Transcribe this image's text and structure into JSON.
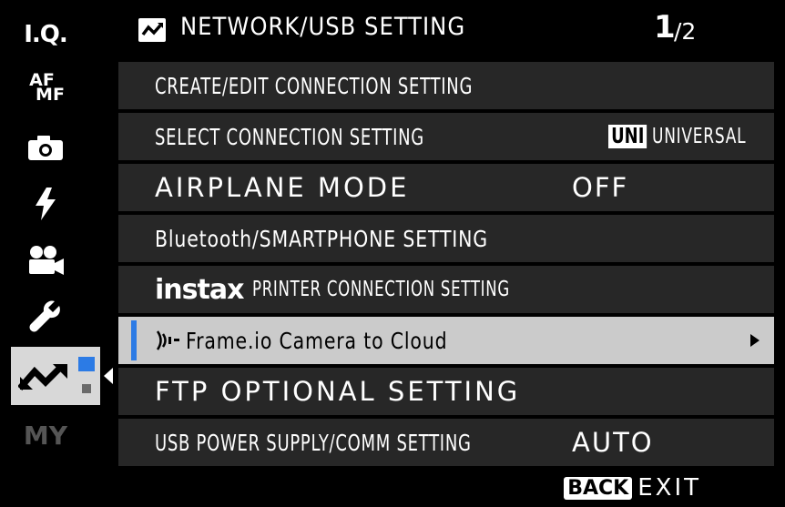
{
  "sidebar": {
    "items": [
      {
        "name": "iq",
        "label": "I.Q."
      },
      {
        "name": "af-mf",
        "label_top": "AF",
        "label_bottom": "MF"
      },
      {
        "name": "camera",
        "icon": "camera-icon"
      },
      {
        "name": "flash",
        "icon": "flash-icon"
      },
      {
        "name": "movie",
        "icon": "movie-camera-icon"
      },
      {
        "name": "setup",
        "icon": "wrench-icon"
      },
      {
        "name": "network",
        "icon": "network-icon",
        "active": true
      },
      {
        "name": "my",
        "label": "MY"
      }
    ]
  },
  "header": {
    "title": "NETWORK/USB SETTING",
    "page": "1",
    "total": "/2"
  },
  "menu": {
    "rows": [
      {
        "label": "CREATE/EDIT CONNECTION SETTING",
        "value": ""
      },
      {
        "label": "SELECT CONNECTION SETTING",
        "badge": "UNI",
        "value": "UNIVERSAL"
      },
      {
        "label": "AIRPLANE MODE",
        "value": "OFF"
      },
      {
        "label": "Bluetooth/SMARTPHONE SETTING",
        "value": ""
      },
      {
        "logo": "instax",
        "label": "PRINTER CONNECTION SETTING",
        "value": ""
      },
      {
        "label": "Frame.io Camera to Cloud",
        "value": "",
        "selected": true
      },
      {
        "label": "FTP OPTIONAL SETTING",
        "value": ""
      },
      {
        "label": "USB POWER SUPPLY/COMM SETTING",
        "value": "AUTO"
      }
    ]
  },
  "footer": {
    "back": "BACK",
    "exit": "EXIT"
  },
  "colors": {
    "accent": "#2c7be5",
    "row_bg": "#272727",
    "selected_bg": "#cbcbcb"
  }
}
